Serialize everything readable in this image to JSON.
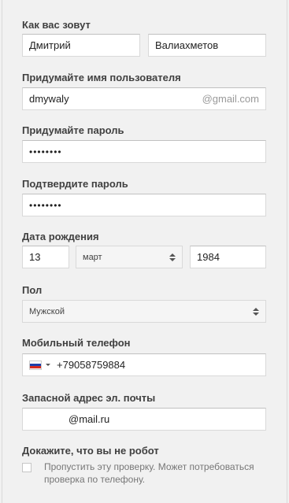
{
  "name": {
    "label": "Как вас зовут",
    "first_name": "Дмитрий",
    "last_name": "Валиахметов"
  },
  "username": {
    "label": "Придумайте имя пользователя",
    "value": "dmywaly",
    "suffix": "@gmail.com"
  },
  "password": {
    "label": "Придумайте пароль",
    "value": "••••••••"
  },
  "confirm_password": {
    "label": "Подтвердите пароль",
    "value": "••••••••"
  },
  "birthdate": {
    "label": "Дата рождения",
    "day": "13",
    "month": "март",
    "year": "1984"
  },
  "gender": {
    "label": "Пол",
    "value": "Мужской"
  },
  "phone": {
    "label": "Мобильный телефон",
    "country_flag": "russia-flag-icon",
    "value": "+79058759884"
  },
  "backup_email": {
    "label": "Запасной адрес эл. почты",
    "value": "@mail.ru"
  },
  "captcha": {
    "label": "Докажите, что вы не робот",
    "skip_text": "Пропустить эту проверку. Может потребоваться проверка по телефону."
  }
}
